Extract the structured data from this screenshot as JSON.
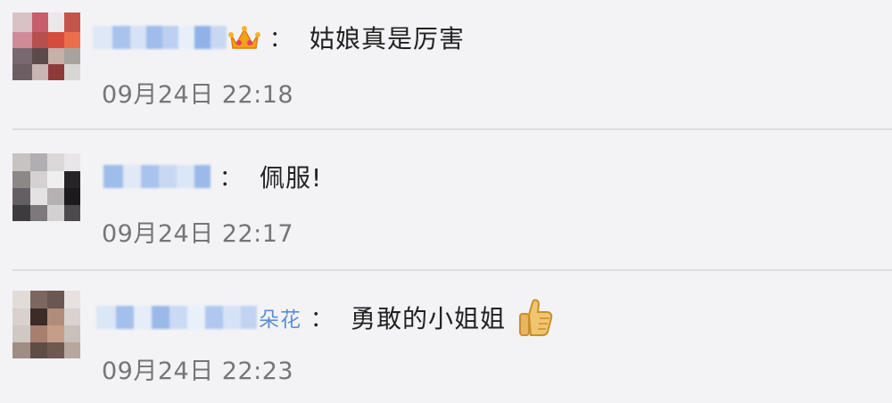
{
  "comments": [
    {
      "author_visible": "",
      "badge": "crown-icon",
      "colon": "：",
      "text": "姑娘真是厉害",
      "time": "09月24日 22:18"
    },
    {
      "author_visible": "",
      "badge": "",
      "colon": "：",
      "text": "佩服!",
      "time": "09月24日 22:17"
    },
    {
      "author_visible": "朵花",
      "badge": "",
      "colon": "：",
      "text": "勇敢的小姐姐",
      "emoji": "thumbs-up-icon",
      "time": "09月24日 22:23"
    }
  ],
  "colors": {
    "background": "#f3f3f6",
    "name": "#5b8fd6",
    "text": "#222222",
    "time": "#757575",
    "divider": "#dddddd"
  }
}
